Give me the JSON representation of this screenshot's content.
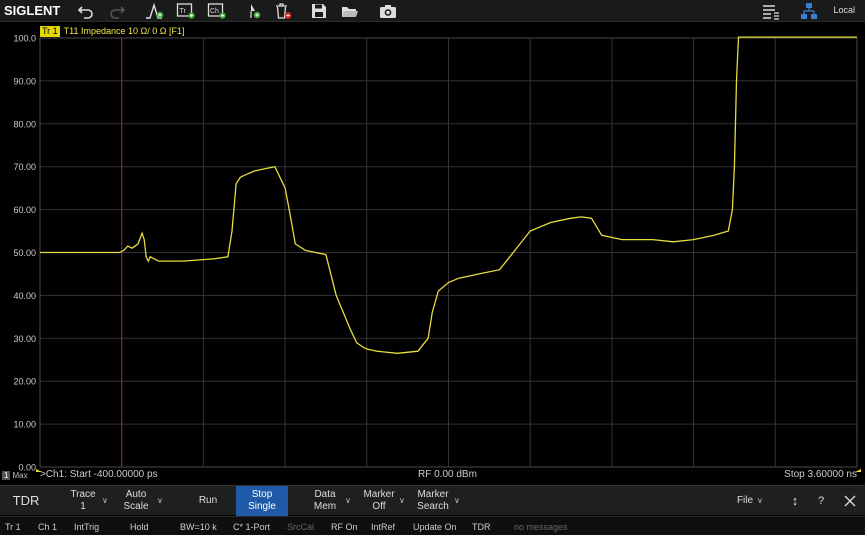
{
  "toolbar": {
    "logo": "SIGLENT",
    "icons": [
      "undo-icon",
      "redo-icon",
      "marker-peak-icon",
      "add-trace-icon",
      "add-channel-icon",
      "add-marker-icon",
      "delete-icon",
      "save-icon",
      "open-icon",
      "screenshot-icon",
      "menu-icon",
      "network-icon"
    ],
    "local_label": "Local"
  },
  "trace_header": {
    "badge": "Tr 1",
    "text": "T11 Impedance 10 Ω/  0 Ω [F1]"
  },
  "chart_data": {
    "type": "line",
    "ylim": [
      0,
      100
    ],
    "yticks": [
      "0.00",
      "10.00",
      "20.00",
      "30.00",
      "40.00",
      "50.00",
      "60.00",
      "70.00",
      "80.00",
      "90.00",
      "100.0"
    ],
    "xlim": [
      -0.4,
      3.6
    ],
    "x_unit": "ns",
    "grid": true,
    "trace_color": "#e6dc3c",
    "cursor_x": 0.0,
    "series": [
      {
        "x": [
          -0.4,
          -0.01,
          0.01,
          0.03,
          0.05,
          0.08,
          0.1,
          0.11,
          0.12,
          0.13,
          0.14,
          0.16,
          0.18,
          0.22,
          0.3,
          0.45,
          0.52,
          0.54,
          0.56,
          0.58,
          0.6,
          0.65,
          0.7,
          0.75,
          0.8,
          0.82,
          0.85,
          0.9,
          0.95,
          1.0,
          1.05,
          1.12,
          1.15,
          1.18,
          1.2,
          1.25,
          1.35,
          1.45,
          1.5,
          1.52,
          1.55,
          1.6,
          1.65,
          1.7,
          1.75,
          1.85,
          1.95,
          2.0,
          2.1,
          2.2,
          2.25,
          2.3,
          2.35,
          2.45,
          2.6,
          2.7,
          2.8,
          2.9,
          2.97,
          2.99,
          3.0,
          3.01,
          3.02,
          3.6
        ],
        "y": [
          50,
          50,
          50.5,
          51.5,
          51,
          52,
          54.5,
          53,
          49,
          48,
          49,
          48.5,
          48,
          48,
          48,
          48.5,
          49,
          55,
          66,
          67.5,
          68,
          69,
          69.5,
          70,
          65,
          60,
          52,
          50.5,
          50,
          49.5,
          40,
          32,
          29,
          28,
          27.5,
          27,
          26.5,
          27,
          30,
          36,
          41,
          43,
          44,
          44.5,
          45,
          46,
          52,
          55,
          57,
          58,
          58.3,
          58,
          54,
          53,
          53,
          52.5,
          53,
          54,
          55,
          60,
          70,
          90,
          101,
          101
        ]
      }
    ]
  },
  "status_line": {
    "max_num": "1",
    "max_label": "Max",
    "start": ">Ch1: Start -400.00000 ps",
    "center": "RF 0.00 dBm",
    "stop": "Stop 3.60000 ns"
  },
  "softkeys": {
    "tdr": "TDR",
    "trace_l1": "Trace",
    "trace_l2": "1",
    "autoscale_l1": "Auto",
    "autoscale_l2": "Scale",
    "run": "Run",
    "stop_l1": "Stop",
    "stop_l2": "Single",
    "data_l1": "Data",
    "data_l2": "Mem",
    "marker_l1": "Marker",
    "marker_l2": "Off",
    "msearch_l1": "Marker",
    "msearch_l2": "Search",
    "file": "File",
    "help": "?"
  },
  "statusbar": {
    "tr": "Tr 1",
    "ch": "Ch 1",
    "trig": "IntTrig",
    "hold": "Hold",
    "bw": "BW=10 k",
    "port": "C* 1-Port",
    "srccal": "SrcCal",
    "rf": "RF On",
    "ref": "IntRef",
    "update": "Update On",
    "mode": "TDR",
    "messages": "no messages"
  }
}
